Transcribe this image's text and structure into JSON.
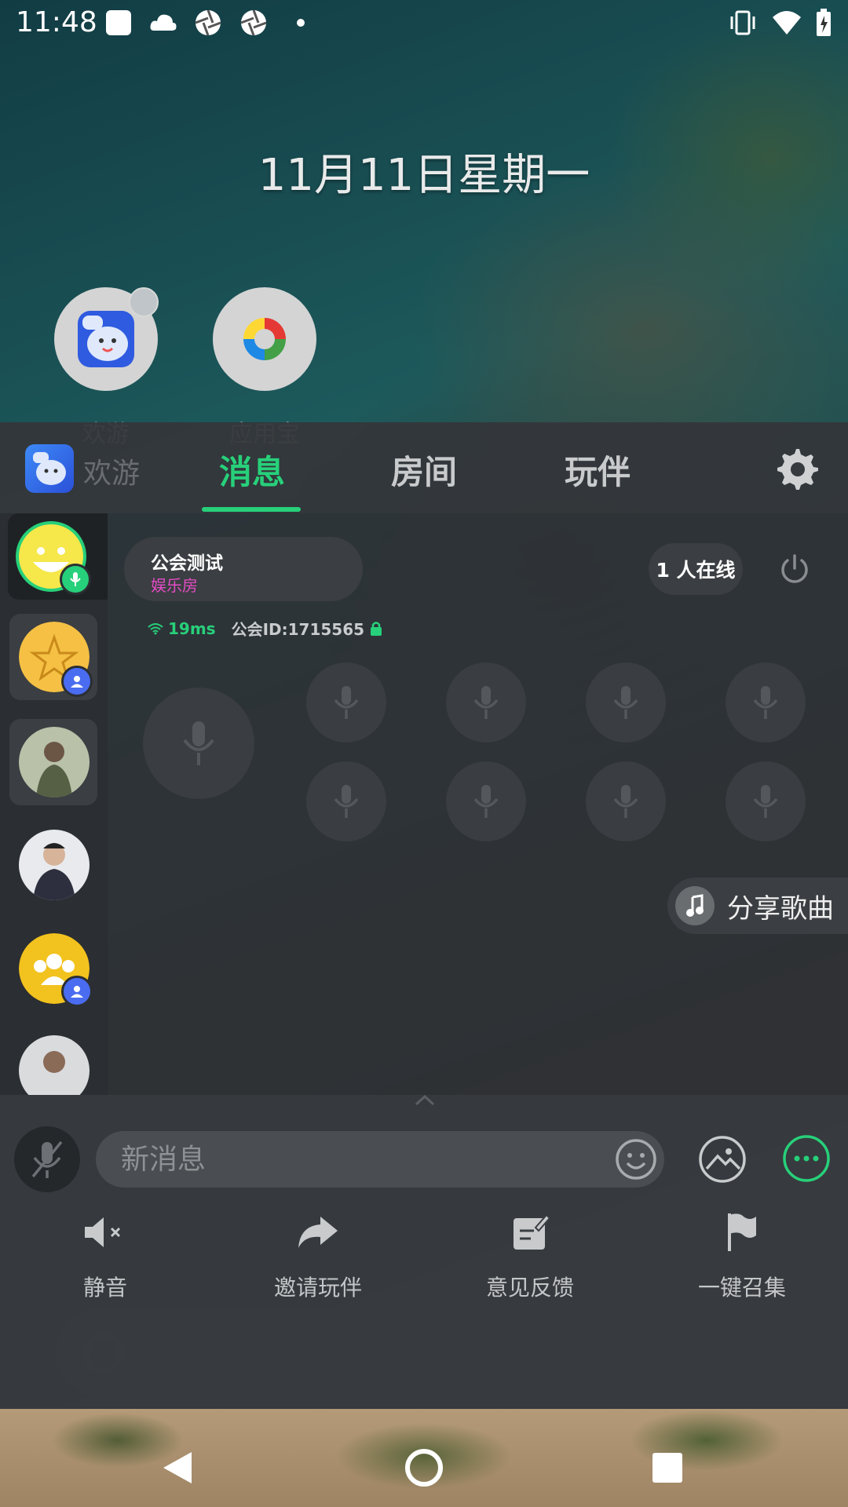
{
  "status_bar": {
    "time": "11:48"
  },
  "home": {
    "date": "11月11日星期一",
    "apps": [
      {
        "label": "欢游"
      },
      {
        "label": "应用宝"
      }
    ]
  },
  "tabs": {
    "logo_text": "欢游",
    "items": [
      {
        "label": "消息"
      },
      {
        "label": "房间"
      },
      {
        "label": "玩伴"
      }
    ],
    "active": "消息"
  },
  "room": {
    "name": "公会测试",
    "type": "娱乐房",
    "ping": "19ms",
    "guild_id": "公会ID:1715565",
    "online": "1 人在线"
  },
  "share_song": {
    "label": "分享歌曲"
  },
  "input": {
    "placeholder": "新消息"
  },
  "actions": [
    {
      "label": "静音",
      "icon": "mute-icon"
    },
    {
      "label": "邀请玩伴",
      "icon": "share-arrow-icon"
    },
    {
      "label": "意见反馈",
      "icon": "feedback-icon"
    },
    {
      "label": "一键召集",
      "icon": "flag-icon"
    }
  ],
  "colors": {
    "accent": "#27d07a",
    "room_type": "#e44cc6",
    "panel": "#2d3034"
  }
}
